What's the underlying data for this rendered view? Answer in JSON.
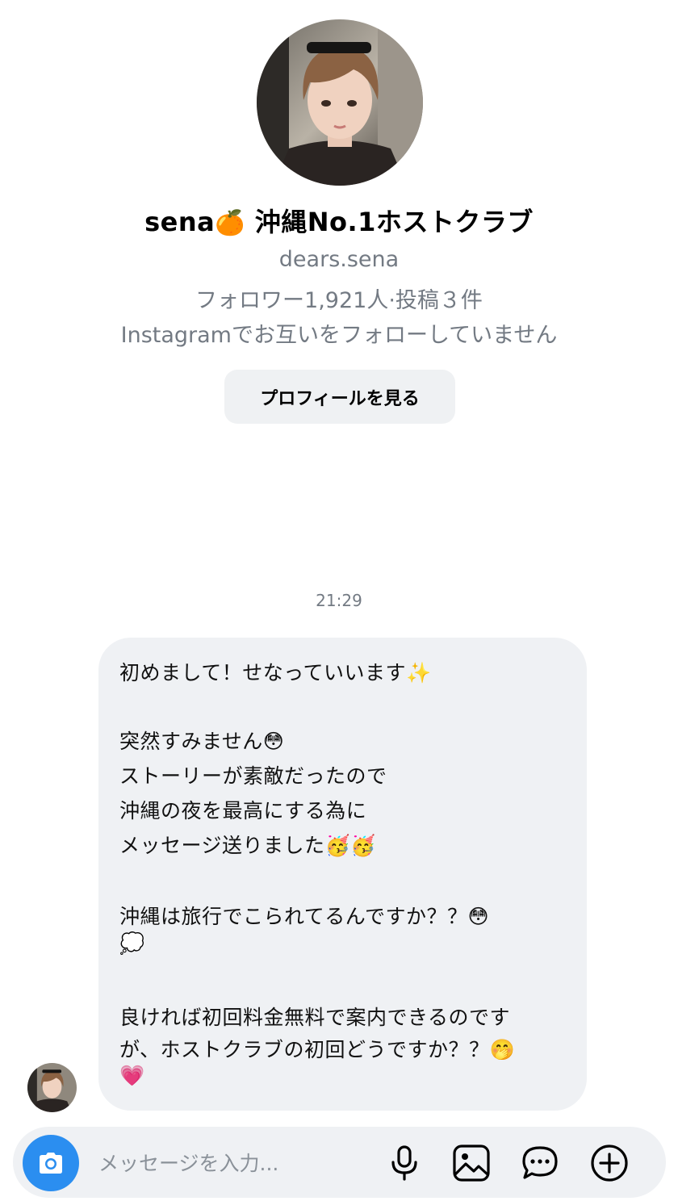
{
  "profile": {
    "name": "sena",
    "name_emoji": "🍊",
    "name_suffix": "沖縄No.1ホストクラブ",
    "username": "dears.sena",
    "stats": "フォロワー1,921人·投稿３件",
    "follow_status": "Instagramでお互いをフォローしていません",
    "view_profile_label": "プロフィールを見る",
    "avatar_icon": "profile-photo"
  },
  "thread": {
    "timestamp": "21:29",
    "message_lines": [
      "初めまして！せなっていいます✨",
      "",
      "突然すみません😳",
      "ストーリーが素敵だったので",
      "沖縄の夜を最高にする為に",
      "メッセージ送りました🥳🥳",
      "",
      "沖縄は旅行でこられてるんですか？？😳",
      "💭",
      "",
      "良ければ初回料金無料で案内できるのです",
      "が、ホストクラブの初回どうですか？？🤭",
      "💗"
    ]
  },
  "composer": {
    "placeholder": "メッセージを入力...",
    "camera_icon": "camera-icon",
    "mic_icon": "microphone-icon",
    "gallery_icon": "image-icon",
    "sticker_icon": "chat-bubble-icon",
    "plus_icon": "plus-circle-icon",
    "accent_color": "#2b8ef0"
  }
}
